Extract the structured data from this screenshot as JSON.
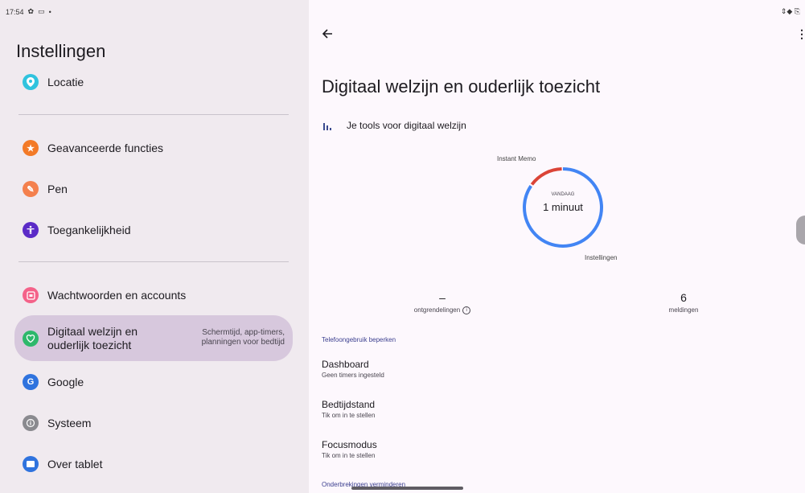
{
  "status": {
    "time": "17:54",
    "right": "⇕◆ ⎘"
  },
  "settings": {
    "title": "Instellingen",
    "items": [
      {
        "label": "Locatie",
        "color": "#30c3de",
        "glyph": "◉"
      },
      {
        "label": "Geavanceerde functies",
        "color": "#f37a27",
        "glyph": "★"
      },
      {
        "label": "Pen",
        "color": "#f4804d",
        "glyph": "✎"
      },
      {
        "label": "Toegankelijkheid",
        "color": "#5b2bc7",
        "glyph": "♿"
      },
      {
        "label": "Wachtwoorden en accounts",
        "color": "#f46289",
        "glyph": "▣"
      },
      {
        "label": "Digitaal welzijn en\nouderlijk toezicht",
        "summary": "Schermtijd, app-timers, planningen voor bedtijd",
        "color": "#2db86b",
        "glyph": "♡"
      },
      {
        "label": "Google",
        "color": "#2f73de",
        "glyph": "G"
      },
      {
        "label": "Systeem",
        "color": "#8a8a8f",
        "glyph": "ⓘ"
      },
      {
        "label": "Over tablet",
        "color": "#2f73de",
        "glyph": "▭"
      }
    ]
  },
  "detail": {
    "title": "Digitaal welzijn en ouderlijk toezicht",
    "tools_label": "Je tools voor digitaal welzijn",
    "chart": {
      "label_top": "Instant Memo",
      "label_bottom": "Instellingen",
      "center_caption": "VANDAAG",
      "center_value": "1 minuut"
    },
    "stats": {
      "unlocks_value": "–",
      "unlocks_label": "ontgrendelingen",
      "notifications_value": "6",
      "notifications_label": "meldingen"
    },
    "section1": "Telefoongebruik beperken",
    "items": [
      {
        "title": "Dashboard",
        "subtitle": "Geen timers ingesteld"
      },
      {
        "title": "Bedtijdstand",
        "subtitle": "Tik om in te stellen"
      },
      {
        "title": "Focusmodus",
        "subtitle": "Tik om in te stellen"
      }
    ],
    "section2": "Onderbrekingen verminderen"
  },
  "chart_data": {
    "type": "pie",
    "series": [
      {
        "name": "Instellingen",
        "value": 0.85,
        "color": "#4285f4"
      },
      {
        "name": "Instant Memo",
        "value": 0.15,
        "color": "#db4437"
      }
    ],
    "center_caption": "VANDAAG",
    "center_value": "1 minuut"
  }
}
